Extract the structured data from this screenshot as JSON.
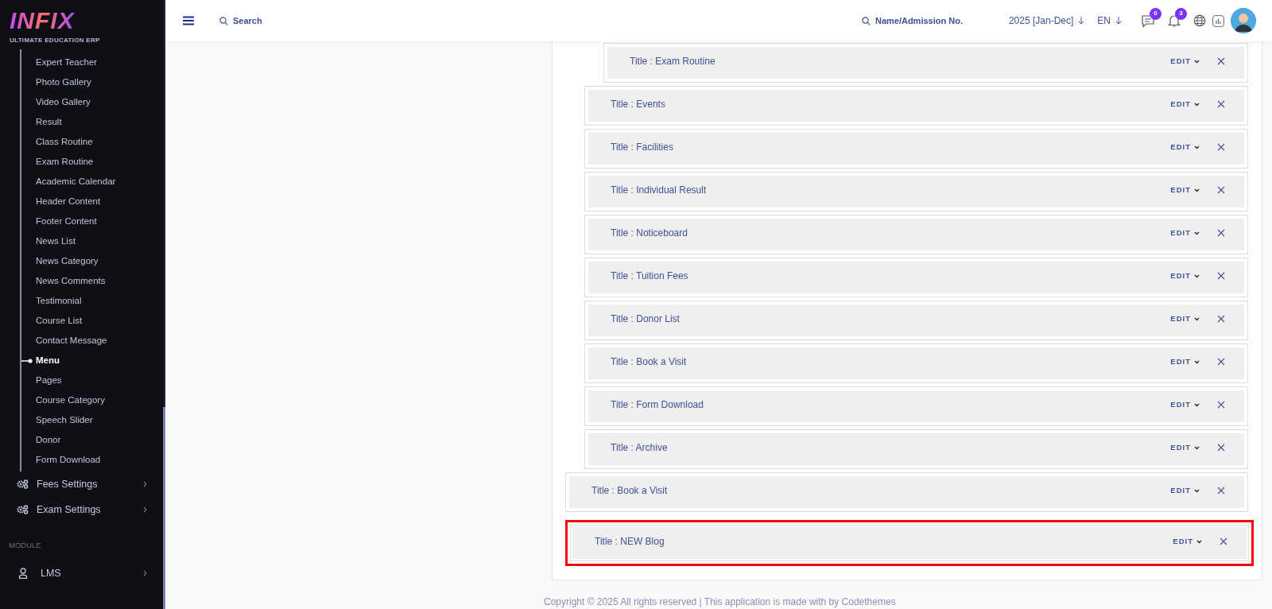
{
  "logo": {
    "wordmark": "INFIX",
    "tagline": "ULTIMATE EDUCATION ERP"
  },
  "sidebar": {
    "sub_items": [
      {
        "label": "Expert Teacher",
        "selected": false
      },
      {
        "label": "Photo Gallery",
        "selected": false
      },
      {
        "label": "Video Gallery",
        "selected": false
      },
      {
        "label": "Result",
        "selected": false
      },
      {
        "label": "Class Routine",
        "selected": false
      },
      {
        "label": "Exam Routine",
        "selected": false
      },
      {
        "label": "Academic Calendar",
        "selected": false
      },
      {
        "label": "Header Content",
        "selected": false
      },
      {
        "label": "Footer Content",
        "selected": false
      },
      {
        "label": "News List",
        "selected": false
      },
      {
        "label": "News Category",
        "selected": false
      },
      {
        "label": "News Comments",
        "selected": false
      },
      {
        "label": "Testimonial",
        "selected": false
      },
      {
        "label": "Course List",
        "selected": false
      },
      {
        "label": "Contact Message",
        "selected": false
      },
      {
        "label": "Menu",
        "selected": true
      },
      {
        "label": "Pages",
        "selected": false
      },
      {
        "label": "Course Category",
        "selected": false
      },
      {
        "label": "Speech Slider",
        "selected": false
      },
      {
        "label": "Donor",
        "selected": false
      },
      {
        "label": "Form Download",
        "selected": false
      }
    ],
    "groups": [
      {
        "label": "Fees Settings"
      },
      {
        "label": "Exam Settings"
      }
    ],
    "section_label": "MODULE",
    "module_items": [
      {
        "label": "LMS"
      }
    ]
  },
  "header": {
    "search_placeholder": "Search",
    "student_search_placeholder": "Name/Admission No.",
    "session": "2025 [Jan-Dec]",
    "language": "EN",
    "message_count": "0",
    "notification_count": "3"
  },
  "menu_items": [
    {
      "children": [
        {
          "children": [
            {
              "title": "Title : Exam Routine",
              "edit_label": "EDIT",
              "selected": false
            }
          ]
        },
        {
          "title": "Title : Events",
          "edit_label": "EDIT",
          "selected": false
        },
        {
          "title": "Title : Facilities",
          "edit_label": "EDIT",
          "selected": false
        },
        {
          "title": "Title : Individual Result",
          "edit_label": "EDIT",
          "selected": false
        },
        {
          "title": "Title : Noticeboard",
          "edit_label": "EDIT",
          "selected": false
        },
        {
          "title": "Title : Tuition Fees",
          "edit_label": "EDIT",
          "selected": false
        },
        {
          "title": "Title : Donor List",
          "edit_label": "EDIT",
          "selected": false
        },
        {
          "title": "Title : Book a Visit",
          "edit_label": "EDIT",
          "selected": false
        },
        {
          "title": "Title : Form Download",
          "edit_label": "EDIT",
          "selected": false
        },
        {
          "title": "Title : Archive",
          "edit_label": "EDIT",
          "selected": false
        }
      ]
    },
    {
      "title": "Title : Book a Visit",
      "edit_label": "EDIT",
      "selected": false
    },
    {
      "title": "Title : NEW Blog",
      "edit_label": "EDIT",
      "selected": true
    }
  ],
  "footer": "Copyright © 2025 All rights reserved | This application is made with by Codethemes"
}
